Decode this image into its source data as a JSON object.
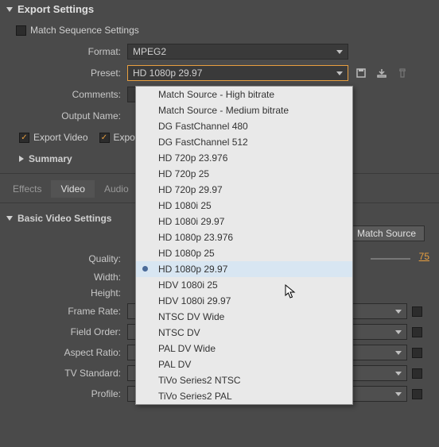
{
  "panel_title": "Export Settings",
  "match_sequence": {
    "label": "Match Sequence Settings",
    "checked": false
  },
  "format": {
    "label": "Format:",
    "value": "MPEG2"
  },
  "preset": {
    "label": "Preset:",
    "value": "HD 1080p 29.97",
    "options": [
      "Match Source - High bitrate",
      "Match Source - Medium bitrate",
      "DG FastChannel 480",
      "DG FastChannel 512",
      "HD 720p 23.976",
      "HD 720p 25",
      "HD 720p 29.97",
      "HD 1080i 25",
      "HD 1080i 29.97",
      "HD 1080p 23.976",
      "HD 1080p 25",
      "HD 1080p 29.97",
      "HDV 1080i 25",
      "HDV 1080i 29.97",
      "NTSC DV Wide",
      "NTSC DV",
      "PAL DV Wide",
      "PAL DV",
      "TiVo Series2 NTSC",
      "TiVo Series2 PAL"
    ],
    "selected_index": 11
  },
  "icons": {
    "save": "save-preset-icon",
    "import": "import-preset-icon",
    "delete": "delete-preset-icon"
  },
  "comments": {
    "label": "Comments:"
  },
  "output_name": {
    "label": "Output Name:"
  },
  "export_video": {
    "label": "Export Video",
    "checked": true
  },
  "export_audio_fragment": {
    "label": "Expor",
    "checked": true
  },
  "summary": {
    "label": "Summary"
  },
  "tabs": {
    "items": [
      "Effects",
      "Video",
      "Audio"
    ],
    "active_index": 1
  },
  "basic_video": {
    "heading": "Basic Video Settings",
    "match_source_btn": "Match Source",
    "fields": {
      "quality": {
        "label": "Quality:",
        "value": "75"
      },
      "width": {
        "label": "Width:"
      },
      "height": {
        "label": "Height:"
      },
      "frame_rate": {
        "label": "Frame Rate:"
      },
      "field_order": {
        "label": "Field Order:"
      },
      "aspect_ratio": {
        "label": "Aspect Ratio:"
      },
      "tv_standard": {
        "label": "TV Standard:"
      },
      "profile": {
        "label": "Profile:"
      }
    }
  }
}
